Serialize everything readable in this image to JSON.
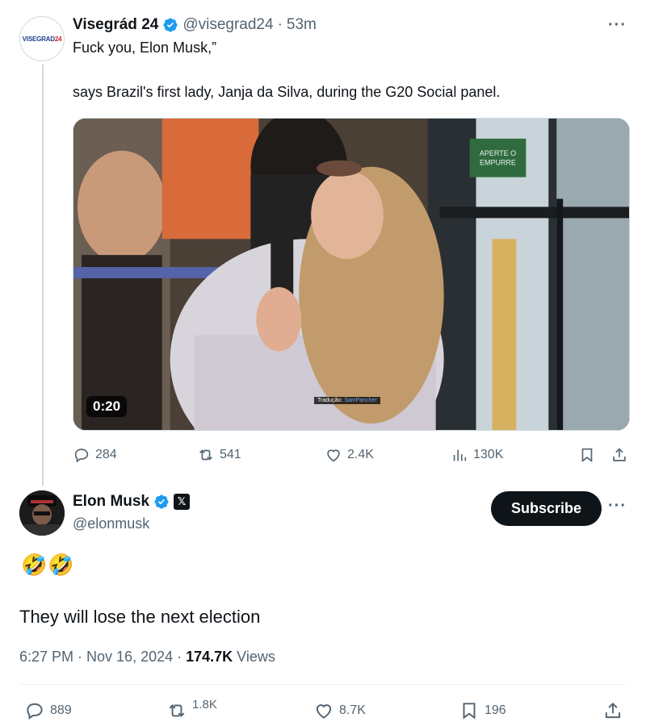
{
  "parent": {
    "avatar_text_a": "VISEGRAD",
    "avatar_text_b": "24",
    "name": "Visegrád 24",
    "handle": "@visegrad24",
    "separator": "·",
    "time": "53m",
    "line1": "Fuck you, Elon Musk,”",
    "line2": "says Brazil's first lady, Janja da Silva, during the G20 Social panel.",
    "video": {
      "duration": "0:20",
      "credit_label": "Tradução:",
      "credit_name": "SamPancher",
      "sign_text": "APERTE O EMPURRE"
    },
    "stats": {
      "replies": "284",
      "reposts": "541",
      "likes": "2.4K",
      "views": "130K"
    }
  },
  "reply": {
    "name": "Elon Musk",
    "x_badge": "𝕏",
    "handle": "@elonmusk",
    "subscribe_label": "Subscribe",
    "emoji": "🤣🤣",
    "text": "They will lose the next election",
    "timestamp": "6:27 PM · Nov 16, 2024 · ",
    "views_count": "174.7K",
    "views_label": " Views",
    "stats": {
      "replies": "889",
      "reposts": "1.8K",
      "likes": "8.7K",
      "bookmarks": "196"
    }
  },
  "more_glyph": "···",
  "colors": {
    "verified": "#1d9bf0",
    "text_secondary": "#536471",
    "subscribe_bg": "#0f1419"
  }
}
